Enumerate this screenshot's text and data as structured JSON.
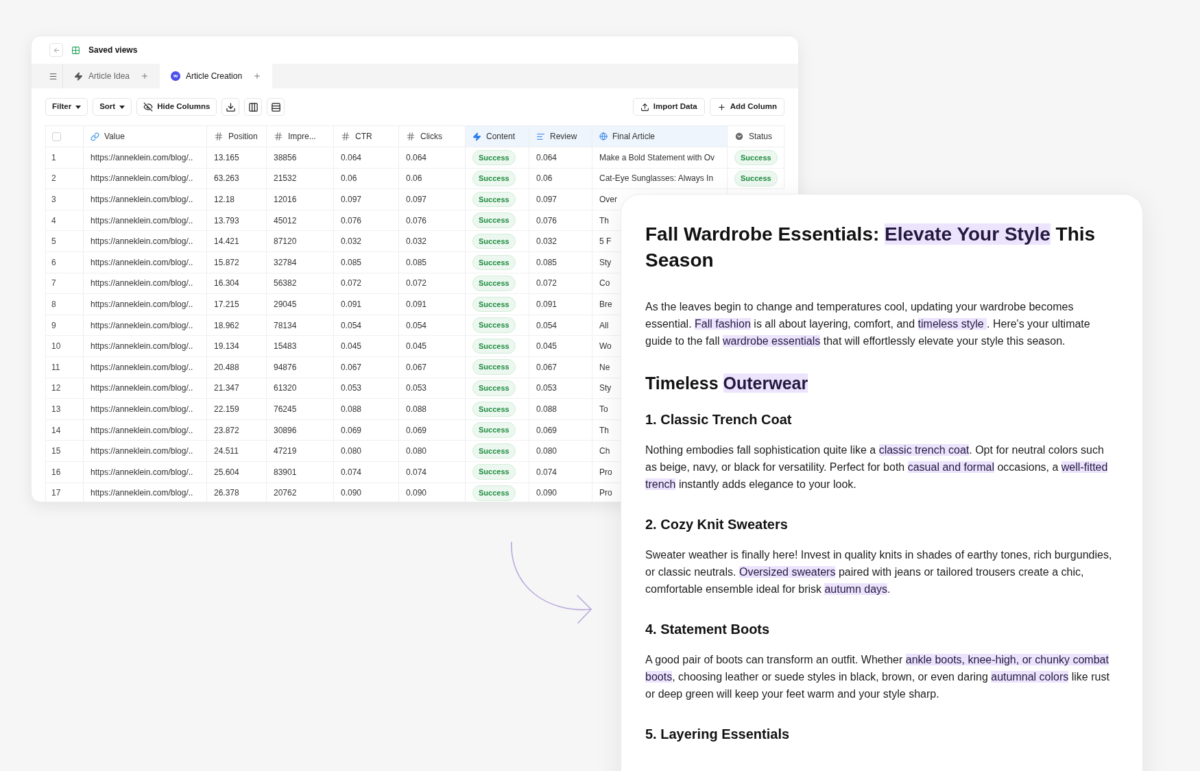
{
  "window": {
    "title": "Saved views"
  },
  "tabs": [
    {
      "label": "Article Idea",
      "kind": "bolt",
      "selected": false
    },
    {
      "label": "Article Creation",
      "kind": "badge",
      "badge": "w",
      "selected": true
    }
  ],
  "toolbar": {
    "left": [
      {
        "label": "Filter",
        "kind": "dropdown"
      },
      {
        "label": "Sort",
        "kind": "dropdown"
      },
      {
        "label": "Hide Columns",
        "kind": "hide"
      },
      {
        "kind": "download"
      },
      {
        "kind": "columns"
      },
      {
        "kind": "rows"
      }
    ],
    "right": [
      {
        "label": "Import Data",
        "kind": "import"
      },
      {
        "label": "Add Column",
        "kind": "add"
      }
    ]
  },
  "table": {
    "select_all": {
      "checked": false
    },
    "columns": [
      {
        "label": "Value",
        "kind": "link",
        "highlighted": false
      },
      {
        "label": "Position",
        "kind": "number",
        "highlighted": false
      },
      {
        "label": "Impre...",
        "kind": "number",
        "highlighted": false
      },
      {
        "label": "CTR",
        "kind": "number",
        "highlighted": false
      },
      {
        "label": "Clicks",
        "kind": "number",
        "highlighted": false
      },
      {
        "label": "Content",
        "kind": "ai",
        "highlighted": true
      },
      {
        "label": "Review",
        "kind": "text",
        "highlighted": true
      },
      {
        "label": "Final Article",
        "kind": "url",
        "highlighted": true
      },
      {
        "label": "Status",
        "kind": "select",
        "highlighted": false
      }
    ],
    "rows": [
      {
        "number": "1",
        "cells": [
          "https://anneklein.com/blog/..",
          "13.165",
          "38856",
          "0.064",
          "0.064",
          "Success",
          "0.064",
          "Make a Bold Statement with Ov",
          "Success"
        ]
      },
      {
        "number": "2",
        "cells": [
          "https://anneklein.com/blog/..",
          "63.263",
          "21532",
          "0.06",
          "0.06",
          "Success",
          "0.06",
          "Cat-Eye Sunglasses: Always In",
          "Success"
        ]
      },
      {
        "number": "3",
        "cells": [
          "https://anneklein.com/blog/..",
          "12.18",
          "12016",
          "0.097",
          "0.097",
          "Success",
          "0.097",
          "Over"
        ]
      },
      {
        "number": "4",
        "cells": [
          "https://anneklein.com/blog/..",
          "13.793",
          "45012",
          "0.076",
          "0.076",
          "Success",
          "0.076",
          "Th"
        ]
      },
      {
        "number": "5",
        "cells": [
          "https://anneklein.com/blog/..",
          "14.421",
          "87120",
          "0.032",
          "0.032",
          "Success",
          "0.032",
          "5 F"
        ]
      },
      {
        "number": "6",
        "cells": [
          "https://anneklein.com/blog/..",
          "15.872",
          "32784",
          "0.085",
          "0.085",
          "Success",
          "0.085",
          "Sty"
        ]
      },
      {
        "number": "7",
        "cells": [
          "https://anneklein.com/blog/..",
          "16.304",
          "56382",
          "0.072",
          "0.072",
          "Success",
          "0.072",
          "Co"
        ]
      },
      {
        "number": "8",
        "cells": [
          "https://anneklein.com/blog/..",
          "17.215",
          "29045",
          "0.091",
          "0.091",
          "Success",
          "0.091",
          "Bre"
        ]
      },
      {
        "number": "9",
        "cells": [
          "https://anneklein.com/blog/..",
          "18.962",
          "78134",
          "0.054",
          "0.054",
          "Success",
          "0.054",
          "All"
        ]
      },
      {
        "number": "10",
        "cells": [
          "https://anneklein.com/blog/..",
          "19.134",
          "15483",
          "0.045",
          "0.045",
          "Success",
          "0.045",
          "Wo"
        ]
      },
      {
        "number": "11",
        "cells": [
          "https://anneklein.com/blog/..",
          "20.488",
          "94876",
          "0.067",
          "0.067",
          "Success",
          "0.067",
          "Ne"
        ]
      },
      {
        "number": "12",
        "cells": [
          "https://anneklein.com/blog/..",
          "21.347",
          "61320",
          "0.053",
          "0.053",
          "Success",
          "0.053",
          "Sty"
        ]
      },
      {
        "number": "13",
        "cells": [
          "https://anneklein.com/blog/..",
          "22.159",
          "76245",
          "0.088",
          "0.088",
          "Success",
          "0.088",
          "To"
        ]
      },
      {
        "number": "14",
        "cells": [
          "https://anneklein.com/blog/..",
          "23.872",
          "30896",
          "0.069",
          "0.069",
          "Success",
          "0.069",
          "Th"
        ]
      },
      {
        "number": "15",
        "cells": [
          "https://anneklein.com/blog/..",
          "24.511",
          "47219",
          "0.080",
          "0.080",
          "Success",
          "0.080",
          "Ch"
        ]
      },
      {
        "number": "16",
        "cells": [
          "https://anneklein.com/blog/..",
          "25.604",
          "83901",
          "0.074",
          "0.074",
          "Success",
          "0.074",
          "Pro"
        ]
      },
      {
        "number": "17",
        "cells": [
          "https://anneklein.com/blog/..",
          "26.378",
          "20762",
          "0.090",
          "0.090",
          "Success",
          "0.090",
          "Pro"
        ]
      }
    ]
  },
  "article": {
    "blocks": [
      {
        "kind": "h1",
        "segments": [
          {
            "text": "Fall Wardrobe Essentials: ",
            "highlighted": false
          },
          {
            "text": "Elevate Your Style",
            "highlighted": true
          },
          {
            "text": " This Season",
            "highlighted": false
          }
        ]
      },
      {
        "kind": "p",
        "segments": [
          {
            "text": "As the leaves begin to change and temperatures cool, updating your wardrobe becomes essential. ",
            "highlighted": false
          },
          {
            "text": "Fall fashion",
            "highlighted": true
          },
          {
            "text": " is all about layering, comfort, and ",
            "highlighted": false
          },
          {
            "text": "timeless style ",
            "highlighted": true
          },
          {
            "text": ". Here's your ultimate guide to the fall ",
            "highlighted": false
          },
          {
            "text": "wardrobe essentials",
            "highlighted": true
          },
          {
            "text": " that will effortlessly elevate your style this season.",
            "highlighted": false
          }
        ]
      },
      {
        "kind": "h2",
        "segments": [
          {
            "text": "Timeless ",
            "highlighted": false
          },
          {
            "text": "Outerwear",
            "highlighted": true
          }
        ]
      },
      {
        "kind": "h3",
        "segments": [
          {
            "text": "1. Classic Trench Coat",
            "highlighted": false
          }
        ]
      },
      {
        "kind": "p",
        "segments": [
          {
            "text": "Nothing embodies fall sophistication quite like a ",
            "highlighted": false
          },
          {
            "text": "classic trench coat",
            "highlighted": true
          },
          {
            "text": ". Opt for neutral colors such as beige, navy, or black for versatility. Perfect for both ",
            "highlighted": false
          },
          {
            "text": "casual and formal",
            "highlighted": true
          },
          {
            "text": " occasions, a ",
            "highlighted": false
          },
          {
            "text": "well-fitted trench",
            "highlighted": true
          },
          {
            "text": " instantly adds elegance to your look.",
            "highlighted": false
          }
        ]
      },
      {
        "kind": "h3",
        "segments": [
          {
            "text": "2. Cozy Knit Sweaters",
            "highlighted": false
          }
        ]
      },
      {
        "kind": "p",
        "segments": [
          {
            "text": "Sweater weather is finally here! Invest in quality knits in shades of earthy tones, rich burgundies, or classic neutrals. ",
            "highlighted": false
          },
          {
            "text": "Oversized sweaters",
            "highlighted": true
          },
          {
            "text": " paired with jeans or tailored trousers create a chic, comfortable ensemble ideal for brisk ",
            "highlighted": false
          },
          {
            "text": "autumn days",
            "highlighted": true
          },
          {
            "text": ".",
            "highlighted": false
          }
        ]
      },
      {
        "kind": "h3",
        "segments": [
          {
            "text": "4. Statement Boots",
            "highlighted": false
          }
        ]
      },
      {
        "kind": "p",
        "segments": [
          {
            "text": "A good pair of boots can transform an outfit. Whether ",
            "highlighted": false
          },
          {
            "text": "ankle boots, knee-high, or chunky combat boots",
            "highlighted": true
          },
          {
            "text": ", choosing leather or suede styles in black, brown, or even daring ",
            "highlighted": false
          },
          {
            "text": "autumnal colors",
            "highlighted": true
          },
          {
            "text": " like rust or deep green will keep your feet warm and your style sharp.",
            "highlighted": false
          }
        ]
      },
      {
        "kind": "h3",
        "segments": [
          {
            "text": "5. Layering Essentials",
            "highlighted": false
          }
        ]
      }
    ]
  }
}
